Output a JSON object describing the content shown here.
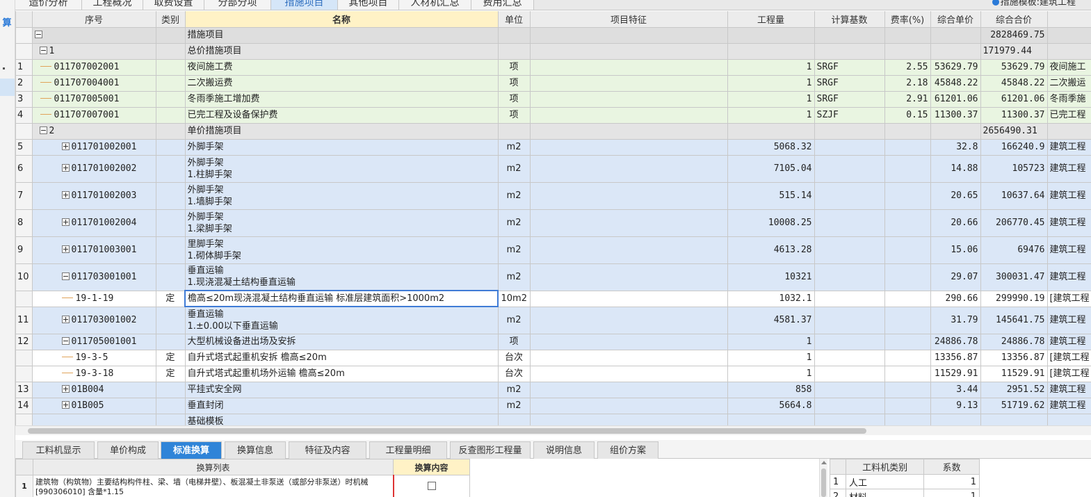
{
  "sidebar": {
    "mark": "算"
  },
  "top_tabs": [
    "造价分析",
    "工程概况",
    "取费设置",
    "分部分项",
    "措施项目",
    "其他项目",
    "人材机汇总",
    "费用汇总"
  ],
  "active_top_tab": "措施项目",
  "template_label": "措施模板:建筑工程",
  "columns": [
    "序号",
    "类别",
    "名称",
    "单位",
    "项目特征",
    "工程量",
    "计算基数",
    "费率(%)",
    "综合单价",
    "综合合价"
  ],
  "rows": [
    {
      "idx": "",
      "code": "",
      "type": "",
      "name": "措施项目",
      "unit": "",
      "feature": "",
      "qty": "",
      "base": "",
      "rate": "",
      "price": "",
      "total": "2828469.75",
      "extra": ""
    },
    {
      "idx": "",
      "code": "1",
      "type": "",
      "name": "总价措施项目",
      "unit": "",
      "feature": "",
      "qty": "",
      "base": "",
      "rate": "",
      "price": "",
      "total": "171979.44",
      "extra": ""
    },
    {
      "idx": "1",
      "code": "011707002001",
      "type": "",
      "name": "夜间施工费",
      "unit": "项",
      "feature": "",
      "qty": "1",
      "base": "SRGF",
      "rate": "2.55",
      "price": "53629.79",
      "total": "53629.79",
      "extra": "夜间施工"
    },
    {
      "idx": "2",
      "code": "011707004001",
      "type": "",
      "name": "二次搬运费",
      "unit": "项",
      "feature": "",
      "qty": "1",
      "base": "SRGF",
      "rate": "2.18",
      "price": "45848.22",
      "total": "45848.22",
      "extra": "二次搬运"
    },
    {
      "idx": "3",
      "code": "011707005001",
      "type": "",
      "name": "冬雨季施工增加费",
      "unit": "项",
      "feature": "",
      "qty": "1",
      "base": "SRGF",
      "rate": "2.91",
      "price": "61201.06",
      "total": "61201.06",
      "extra": "冬雨季施"
    },
    {
      "idx": "4",
      "code": "011707007001",
      "type": "",
      "name": "已完工程及设备保护费",
      "unit": "项",
      "feature": "",
      "qty": "1",
      "base": "SZJF",
      "rate": "0.15",
      "price": "11300.37",
      "total": "11300.37",
      "extra": "已完工程"
    },
    {
      "idx": "",
      "code": "2",
      "type": "",
      "name": "单价措施项目",
      "unit": "",
      "feature": "",
      "qty": "",
      "base": "",
      "rate": "",
      "price": "",
      "total": "2656490.31",
      "extra": ""
    },
    {
      "idx": "5",
      "code": "011701002001",
      "type": "",
      "name": "外脚手架",
      "unit": "m2",
      "feature": "",
      "qty": "5068.32",
      "base": "",
      "rate": "",
      "price": "32.8",
      "total": "166240.9",
      "extra": "建筑工程"
    },
    {
      "idx": "6",
      "code": "011701002002",
      "type": "",
      "name": "外脚手架\n1.柱脚手架",
      "unit": "m2",
      "feature": "",
      "qty": "7105.04",
      "base": "",
      "rate": "",
      "price": "14.88",
      "total": "105723",
      "extra": "建筑工程"
    },
    {
      "idx": "7",
      "code": "011701002003",
      "type": "",
      "name": "外脚手架\n1.墙脚手架",
      "unit": "m2",
      "feature": "",
      "qty": "515.14",
      "base": "",
      "rate": "",
      "price": "20.65",
      "total": "10637.64",
      "extra": "建筑工程"
    },
    {
      "idx": "8",
      "code": "011701002004",
      "type": "",
      "name": "外脚手架\n1.梁脚手架",
      "unit": "m2",
      "feature": "",
      "qty": "10008.25",
      "base": "",
      "rate": "",
      "price": "20.66",
      "total": "206770.45",
      "extra": "建筑工程"
    },
    {
      "idx": "9",
      "code": "011701003001",
      "type": "",
      "name": "里脚手架\n1.砌体脚手架",
      "unit": "m2",
      "feature": "",
      "qty": "4613.28",
      "base": "",
      "rate": "",
      "price": "15.06",
      "total": "69476",
      "extra": "建筑工程"
    },
    {
      "idx": "10",
      "code": "011703001001",
      "type": "",
      "name": "垂直运输\n1.现浇混凝土结构垂直运输",
      "unit": "m2",
      "feature": "",
      "qty": "10321",
      "base": "",
      "rate": "",
      "price": "29.07",
      "total": "300031.47",
      "extra": "建筑工程"
    },
    {
      "idx": "",
      "code": "19-1-19",
      "type": "定",
      "name": "檐高≤20m现浇混凝土结构垂直运输 标准层建筑面积>1000m2",
      "unit": "10m2",
      "feature": "",
      "qty": "1032.1",
      "base": "",
      "rate": "",
      "price": "290.66",
      "total": "299990.19",
      "extra": "[建筑工程"
    },
    {
      "idx": "11",
      "code": "011703001002",
      "type": "",
      "name": "垂直运输\n1.±0.00以下垂直运输",
      "unit": "m2",
      "feature": "",
      "qty": "4581.37",
      "base": "",
      "rate": "",
      "price": "31.79",
      "total": "145641.75",
      "extra": "建筑工程"
    },
    {
      "idx": "12",
      "code": "011705001001",
      "type": "",
      "name": "大型机械设备进出场及安拆",
      "unit": "项",
      "feature": "",
      "qty": "1",
      "base": "",
      "rate": "",
      "price": "24886.78",
      "total": "24886.78",
      "extra": "建筑工程"
    },
    {
      "idx": "",
      "code": "19-3-5",
      "type": "定",
      "name": "自升式塔式起重机安拆 檐高≤20m",
      "unit": "台次",
      "feature": "",
      "qty": "1",
      "base": "",
      "rate": "",
      "price": "13356.87",
      "total": "13356.87",
      "extra": "[建筑工程"
    },
    {
      "idx": "",
      "code": "19-3-18",
      "type": "定",
      "name": "自升式塔式起重机场外运输 檐高≤20m",
      "unit": "台次",
      "feature": "",
      "qty": "1",
      "base": "",
      "rate": "",
      "price": "11529.91",
      "total": "11529.91",
      "extra": "[建筑工程"
    },
    {
      "idx": "13",
      "code": "01B004",
      "type": "",
      "name": "平挂式安全网",
      "unit": "m2",
      "feature": "",
      "qty": "858",
      "base": "",
      "rate": "",
      "price": "3.44",
      "total": "2951.52",
      "extra": "建筑工程"
    },
    {
      "idx": "14",
      "code": "01B005",
      "type": "",
      "name": "垂直封闭",
      "unit": "m2",
      "feature": "",
      "qty": "5664.8",
      "base": "",
      "rate": "",
      "price": "9.13",
      "total": "51719.62",
      "extra": "建筑工程"
    },
    {
      "idx": "",
      "code": "",
      "type": "",
      "name": "基础模板",
      "unit": "",
      "feature": "",
      "qty": "",
      "base": "",
      "rate": "",
      "price": "",
      "total": "",
      "extra": ""
    }
  ],
  "bottom_tabs": [
    "工料机显示",
    "单价构成",
    "标准换算",
    "换算信息",
    "特征及内容",
    "工程量明细",
    "反查图形工程量",
    "说明信息",
    "组价方案"
  ],
  "active_bottom_tab": "标准换算",
  "calc_panel": {
    "headers": [
      "换算列表",
      "换算内容"
    ],
    "rows": [
      {
        "idx": "1",
        "text": "建筑物（构筑物）主要结构构件柱、梁、墙（电梯井壁）、板混凝土非泵送（或部分非泵送）时机械[990306010] 含量*1.15"
      }
    ]
  },
  "res_panel": {
    "headers": [
      "工料机类别",
      "系数"
    ],
    "rows": [
      {
        "idx": "1",
        "type": "人工",
        "coef": "1"
      },
      {
        "idx": "2",
        "type": "材料",
        "coef": "1"
      }
    ]
  }
}
